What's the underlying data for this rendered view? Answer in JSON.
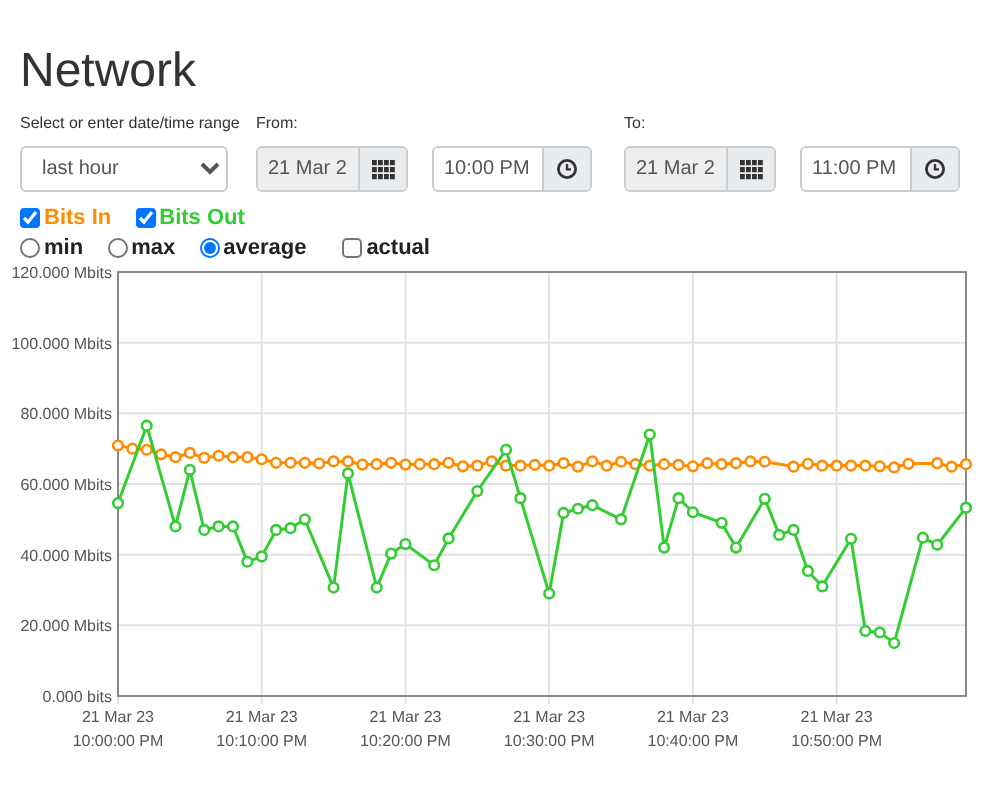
{
  "title": "Network",
  "range": {
    "label": "Select or enter date/time range",
    "value": "last hour"
  },
  "from": {
    "label": "From:",
    "date": {
      "value": "21 Mar 2",
      "disabled": true
    },
    "time": {
      "value": "10:00 PM",
      "disabled": false
    }
  },
  "to": {
    "label": "To:",
    "date": {
      "value": "21 Mar 2",
      "disabled": true
    },
    "time": {
      "value": "11:00 PM",
      "disabled": false
    }
  },
  "series_toggles": [
    {
      "label": "Bits In",
      "checked": true,
      "color": "#ff8c00"
    },
    {
      "label": "Bits Out",
      "checked": true,
      "color": "#33cc33"
    }
  ],
  "modes": [
    {
      "kind": "radio",
      "label": "min",
      "selected": false
    },
    {
      "kind": "radio",
      "label": "max",
      "selected": false
    },
    {
      "kind": "radio",
      "label": "average",
      "selected": true
    },
    {
      "kind": "checkbox",
      "label": "actual",
      "selected": false
    }
  ],
  "chart": {
    "chart_data": {
      "type": "line",
      "grid": true,
      "categories": [
        "21 Mar 23\n10:00:00 PM",
        null,
        null,
        null,
        null,
        null,
        null,
        null,
        null,
        null,
        "21 Mar 23\n10:10:00 PM",
        null,
        null,
        null,
        null,
        null,
        null,
        null,
        null,
        null,
        "21 Mar 23\n10:20:00 PM",
        null,
        null,
        null,
        null,
        null,
        null,
        null,
        null,
        null,
        "21 Mar 23\n10:30:00 PM",
        null,
        null,
        null,
        null,
        null,
        null,
        null,
        null,
        null,
        "21 Mar 23\n10:40:00 PM",
        null,
        null,
        null,
        null,
        null,
        null,
        null,
        null,
        null,
        "21 Mar 23\n10:50:00 PM",
        null,
        null,
        null,
        null,
        null,
        null,
        null,
        null,
        null
      ],
      "ylim": [
        0,
        120
      ],
      "yticks": [
        {
          "value": 0,
          "label": "0.000 bits"
        },
        {
          "value": 20,
          "label": "20.000 Mbits"
        },
        {
          "value": 40,
          "label": "40.000 Mbits"
        },
        {
          "value": 60,
          "label": "60.000 Mbits"
        },
        {
          "value": 80,
          "label": "80.000 Mbits"
        },
        {
          "value": 100,
          "label": "100.000 Mbits"
        },
        {
          "value": 120,
          "label": "120.000 Mbits"
        }
      ],
      "series": [
        {
          "color": "#ff8c00",
          "marker": "circle",
          "values": [
            70.9,
            70,
            69.7,
            68.4,
            67.6,
            68.8,
            67.4,
            68,
            67.6,
            67.6,
            67,
            66,
            66,
            66,
            65.8,
            66.4,
            66.4,
            65.5,
            65.6,
            66,
            65.5,
            65.6,
            65.6,
            66,
            65,
            65.2,
            66.4,
            65.2,
            65.2,
            65.4,
            65.2,
            65.9,
            64.9,
            66.4,
            65.2,
            66.3,
            65.6,
            65.2,
            65.6,
            65.4,
            65,
            65.9,
            65.6,
            65.9,
            66.4,
            66.3,
            null,
            64.9,
            65.7,
            65.2,
            65.2,
            65.2,
            65.2,
            65,
            64.7,
            65.7,
            null,
            65.9,
            64.9,
            65.6
          ]
        },
        {
          "color": "#33cc33",
          "marker": "circle",
          "values": [
            54.6,
            null,
            76.5,
            null,
            48,
            64,
            47,
            48,
            48,
            38,
            39.5,
            47,
            47.5,
            50,
            null,
            30.7,
            63,
            null,
            30.7,
            40.3,
            43,
            null,
            37,
            44.6,
            null,
            58,
            null,
            69.7,
            56,
            null,
            29,
            51.8,
            53,
            54,
            null,
            50,
            null,
            74,
            42,
            56,
            52,
            null,
            49,
            42,
            null,
            55.8,
            45.6,
            47,
            35.4,
            31,
            null,
            44.5,
            18.4,
            18,
            15,
            null,
            44.8,
            42.8,
            null,
            53.3
          ]
        }
      ]
    }
  }
}
